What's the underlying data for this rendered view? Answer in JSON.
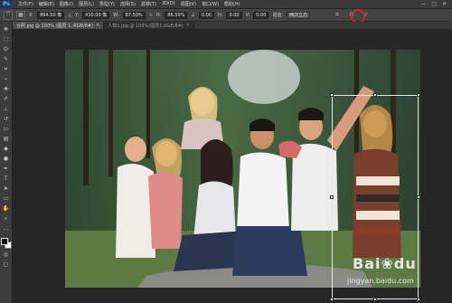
{
  "app": {
    "logo": "Ps"
  },
  "menu": [
    "文件(F)",
    "编辑(E)",
    "图像(I)",
    "图层(L)",
    "类型(Y)",
    "选择(S)",
    "滤镜(T)",
    "3D(D)",
    "视图(V)",
    "窗口(W)",
    "帮助(H)"
  ],
  "window_controls": [
    "—",
    "□",
    "✕"
  ],
  "options": {
    "x_label": "X:",
    "x_value": "864.50 像",
    "y_label": "Y:",
    "y_value": "410.00 像",
    "w_label": "W:",
    "w_value": "87.50%",
    "h_label": "H:",
    "h_value": "86.59%",
    "angle_value": "0.00",
    "h_skew_label": "H:",
    "h_skew_value": "0.00",
    "v_label": "V:",
    "v_value": "0.00",
    "interp_label": "插值:",
    "interp_value": "两次立方"
  },
  "tabs": [
    {
      "label": "合照.jpg @ 100% (图层 1, RGB/8#)",
      "close": "×",
      "active": true
    },
    {
      "label": "人物1.jpg @ 100%(图层1,RGB/8#)",
      "close": "×",
      "active": false
    }
  ],
  "watermark": {
    "brand": "Bai",
    "brand2": "du",
    "sub": "jingyan.baidu.com"
  },
  "colors": {
    "accent_red": "#d02626"
  }
}
